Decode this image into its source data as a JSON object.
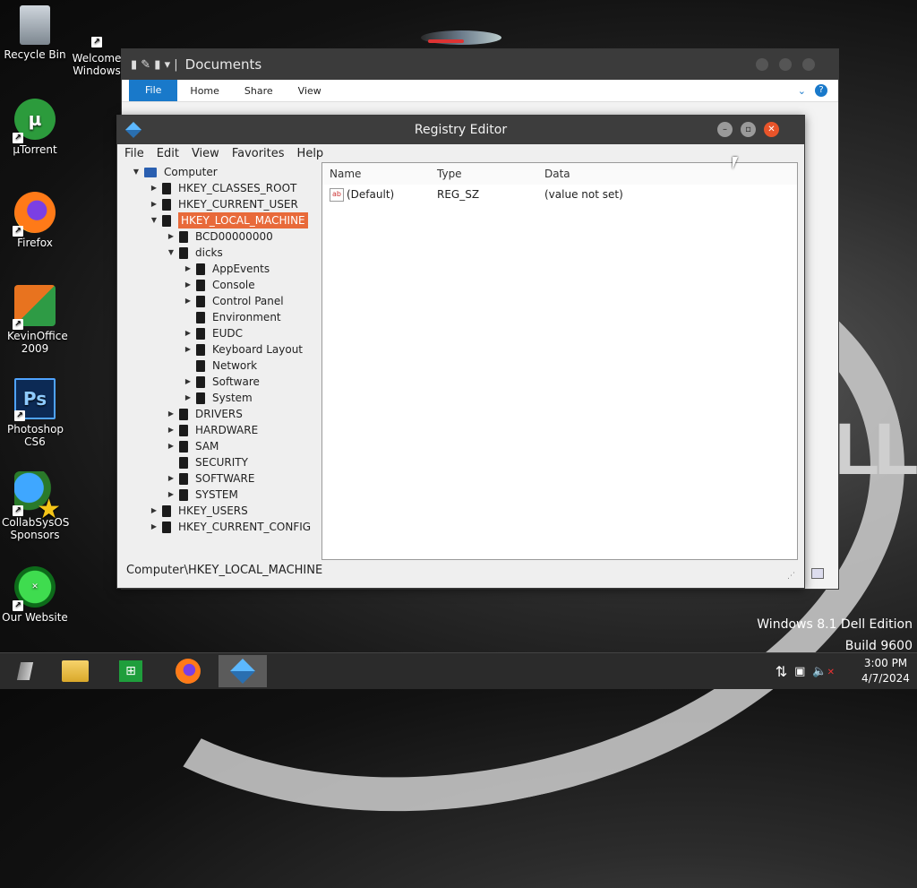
{
  "desktop": {
    "icons": [
      {
        "label": "Recycle Bin",
        "icon": "recycle-bin-icon"
      },
      {
        "label": "Welcome Windows",
        "icon": "welcome-icon"
      },
      {
        "label": "µTorrent",
        "icon": "utorrent-icon"
      },
      {
        "label": "Firefox",
        "icon": "firefox-icon"
      },
      {
        "label": "KevinOffice 2009",
        "icon": "office-icon"
      },
      {
        "label": "Photoshop CS6",
        "icon": "photoshop-icon"
      },
      {
        "label": "CollabSysOS Sponsors",
        "icon": "collab-sponsors-icon"
      },
      {
        "label": "Our Website",
        "icon": "website-icon"
      }
    ],
    "edition_line1": "Windows 8.1 Dell Edition",
    "edition_line2": "Build 9600",
    "wallpaper_logo": "LL"
  },
  "explorer": {
    "title": "Documents",
    "ribbon_tabs": [
      "File",
      "Home",
      "Share",
      "View"
    ]
  },
  "regedit": {
    "title": "Registry Editor",
    "menu": [
      "File",
      "Edit",
      "View",
      "Favorites",
      "Help"
    ],
    "tree": [
      {
        "label": "Computer",
        "arrow": "▼"
      },
      {
        "label": "HKEY_CLASSES_ROOT",
        "arrow": "▶"
      },
      {
        "label": "HKEY_CURRENT_USER",
        "arrow": "▶"
      },
      {
        "label": "HKEY_LOCAL_MACHINE",
        "arrow": "▼"
      },
      {
        "label": "BCD00000000",
        "arrow": "▶"
      },
      {
        "label": "dicks",
        "arrow": "▼"
      },
      {
        "label": "AppEvents",
        "arrow": "▶"
      },
      {
        "label": "Console",
        "arrow": "▶"
      },
      {
        "label": "Control Panel",
        "arrow": "▶"
      },
      {
        "label": "Environment",
        "arrow": ""
      },
      {
        "label": "EUDC",
        "arrow": "▶"
      },
      {
        "label": "Keyboard Layout",
        "arrow": "▶"
      },
      {
        "label": "Network",
        "arrow": ""
      },
      {
        "label": "Software",
        "arrow": "▶"
      },
      {
        "label": "System",
        "arrow": "▶"
      },
      {
        "label": "DRIVERS",
        "arrow": "▶"
      },
      {
        "label": "HARDWARE",
        "arrow": "▶"
      },
      {
        "label": "SAM",
        "arrow": "▶"
      },
      {
        "label": "SECURITY",
        "arrow": ""
      },
      {
        "label": "SOFTWARE",
        "arrow": "▶"
      },
      {
        "label": "SYSTEM",
        "arrow": "▶"
      },
      {
        "label": "HKEY_USERS",
        "arrow": "▶"
      },
      {
        "label": "HKEY_CURRENT_CONFIG",
        "arrow": "▶"
      }
    ],
    "columns": [
      "Name",
      "Type",
      "Data"
    ],
    "values": [
      {
        "name": "(Default)",
        "type": "REG_SZ",
        "data": "(value not set)",
        "icon": "ab-string-icon"
      }
    ],
    "status": "Computer\\HKEY_LOCAL_MACHINE"
  },
  "taskbar": {
    "apps": [
      "start-button",
      "file-explorer-icon",
      "store-icon",
      "firefox-icon",
      "regedit-icon"
    ],
    "time": "3:00 PM",
    "date": "4/7/2024"
  },
  "colors": {
    "selection": "#e86a3a",
    "titlebar": "#3d3d3d",
    "ribbon_file": "#1979ca"
  }
}
